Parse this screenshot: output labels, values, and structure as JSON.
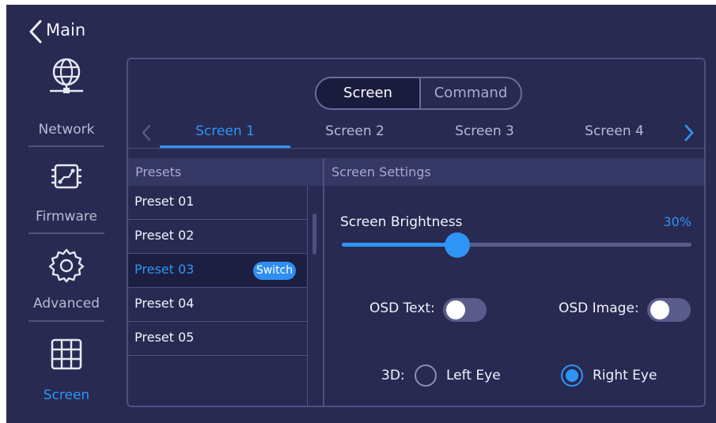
{
  "header": {
    "back_label": "Main"
  },
  "sidebar": {
    "items": [
      {
        "label": "Network",
        "icon": "globe-network-icon"
      },
      {
        "label": "Firmware",
        "icon": "chip-icon"
      },
      {
        "label": "Advanced",
        "icon": "gear-icon"
      },
      {
        "label": "Screen",
        "icon": "grid-icon"
      }
    ],
    "active": "Screen"
  },
  "segmented": {
    "options": [
      "Screen",
      "Command"
    ],
    "active": "Screen"
  },
  "tabs": {
    "items": [
      "Screen 1",
      "Screen 2",
      "Screen 3",
      "Screen 4"
    ],
    "active": "Screen 1"
  },
  "presets": {
    "header": "Presets",
    "items": [
      "Preset 01",
      "Preset 02",
      "Preset 03",
      "Preset 04",
      "Preset 05"
    ],
    "selected": "Preset 03",
    "switch_label": "Switch"
  },
  "settings": {
    "header": "Screen Settings",
    "brightness_label": "Screen Brightness",
    "brightness_value": "30%",
    "brightness_fraction": 0.33,
    "osd_text_label": "OSD Text:",
    "osd_text_on": false,
    "osd_image_label": "OSD Image:",
    "osd_image_on": false,
    "threed_label": "3D:",
    "left_eye_label": "Left Eye",
    "right_eye_label": "Right Eye",
    "threed_selected": "Right Eye"
  },
  "colors": {
    "background": "#282a52",
    "accent": "#2f95f5",
    "border": "#4d5182"
  }
}
